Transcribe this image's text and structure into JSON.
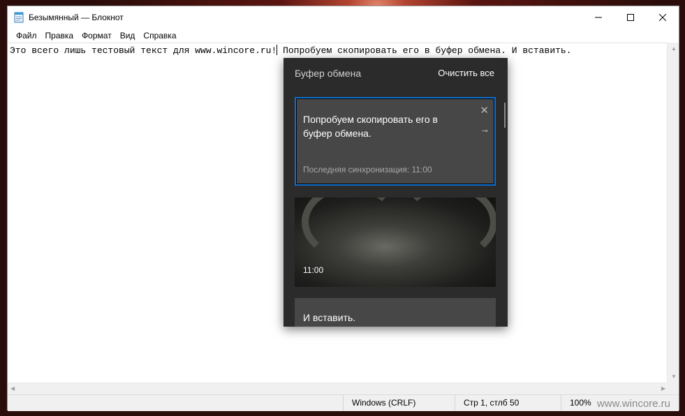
{
  "window": {
    "title": "Безымянный — Блокнот",
    "minimize_glyph": "—",
    "maximize_glyph": "☐",
    "close_glyph": "✕"
  },
  "menu": [
    "Файл",
    "Правка",
    "Формат",
    "Вид",
    "Справка"
  ],
  "editor": {
    "text_before_caret": "Это всего лишь тестовый текст для www.wincore.ru!",
    "text_after_caret": " Попробуем скопировать его в буфер обмена. И вставить."
  },
  "statusbar": {
    "encoding": "Windows (CRLF)",
    "position": "Стр 1, стлб 50",
    "zoom": "100%"
  },
  "watermark": "www.wincore.ru",
  "clipboard": {
    "header": "Буфер обмена",
    "clear_all": "Очистить все",
    "items": [
      {
        "text": "Попробуем скопировать его в буфер обмена.",
        "sync": "Последняя синхронизация: 11:00",
        "close_glyph": "✕",
        "pin_glyph": "⊸"
      },
      {
        "time": "11:00"
      },
      {
        "text": "И вставить."
      }
    ]
  },
  "icons": {
    "app": "notepad-icon",
    "close": "close-icon",
    "pin": "pin-icon"
  },
  "colors": {
    "selection_border": "#0f6fd1",
    "flyout_bg": "#2b2b2b",
    "item_bg": "#474747"
  }
}
